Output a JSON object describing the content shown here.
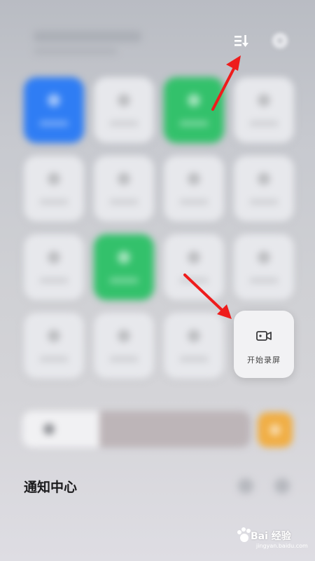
{
  "header": {
    "sort_icon": "sort-list-icon",
    "settings_icon": "settings-icon"
  },
  "screen_record": {
    "label": "开始录屏",
    "icon": "video-camera-icon"
  },
  "notification_center": {
    "title": "通知中心"
  },
  "watermark": {
    "brand": "Bai 经验",
    "url": "jingyan.baidu.com"
  },
  "colors": {
    "blue_tile": "#2f7df4",
    "green_tile": "#33c16b",
    "orange_tile": "#f0ae45",
    "annotation_red": "#ee1c1c"
  }
}
